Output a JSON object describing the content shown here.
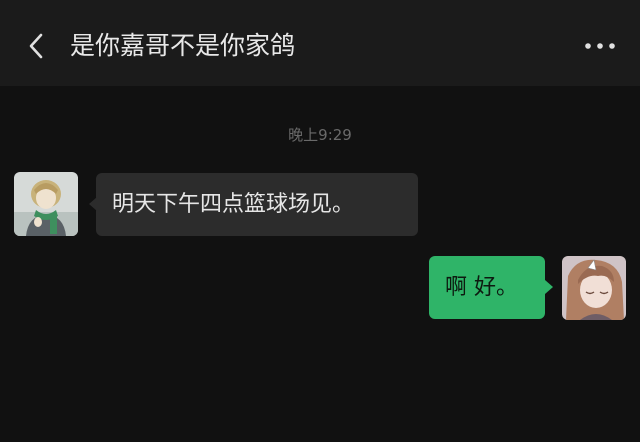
{
  "header": {
    "title": "是你嘉哥不是你家鸽",
    "back_icon": "chevron-left-icon",
    "more_icon": "more-dots-icon"
  },
  "chat": {
    "timestamp": "晚上9:29",
    "messages": [
      {
        "from": "contact",
        "text": "明天下午四点篮球场见。",
        "avatar": "contact-avatar"
      },
      {
        "from": "me",
        "text": "啊 好。",
        "avatar": "my-avatar"
      }
    ]
  },
  "colors": {
    "background": "#111111",
    "header": "#1b1b1b",
    "incoming_bubble": "#2c2c2c",
    "outgoing_bubble": "#2fb468"
  }
}
